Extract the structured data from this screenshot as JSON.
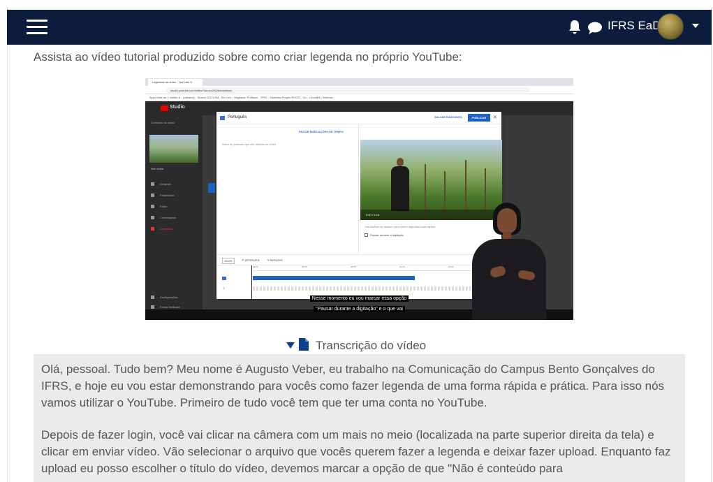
{
  "navbar": {
    "menu_icon": "hamburger-menu-icon",
    "notification_icon": "bell-icon",
    "messages_icon": "chat-bubble-icon",
    "user_name": "IFRS EaD",
    "background": "#0c1c3c"
  },
  "content": {
    "intro": "Assista ao vídeo tutorial produzido sobre como criar legenda no próprio YouTube:"
  },
  "video": {
    "browser_tab": "Legendas do vídeo - YouTube S",
    "url": "studio.youtube.com/video/?jm-svz0tQ/translations",
    "bookmarks": "Apps   Mais de 1 milhão d...   pdfcandy... Search   502.3 FM - Rio Gra...   Wayback: Profissio...   IFRS - Sistemas   Projeto RISOS - Go...   LinuxBR | Sistema...",
    "studio_label": "Studio",
    "sidebar": {
      "channel": "Conteúdo do canal",
      "video_title": "Seu vídeo",
      "items": [
        "Detalhes",
        "Estatísticas",
        "Editor",
        "Comentários",
        "Legendas"
      ],
      "footer": [
        "Configurações",
        "Enviar feedback"
      ]
    },
    "modal": {
      "title": "Português",
      "draft": "SALVAR RASCUNHO",
      "publish": "PUBLICAR",
      "edit_timestamps": "EDITAR MARCAÇÕES DE TEMPO",
      "hint": "Insira as palavras que são faladas no vídeo",
      "player_time": "0:00 / 0:18",
      "keyboard_link": "Use atalhos de teclado para inserir legendas mais rápido",
      "pause_option": "Pausar durante a digitação",
      "timeline_time": "00:00",
      "undo": "DESFAZER",
      "redo": "REFAZER",
      "ruler": [
        "00:00",
        "00:15",
        "00:30",
        "00:45",
        "01:00"
      ]
    },
    "captions": {
      "line1": "Nesse momento eu vou marcar essa opção",
      "line2": "\"Pausar durante a digitação\" e o que vai"
    }
  },
  "transcript": {
    "toggle_icon": "triangle-down-icon",
    "doc_icon": "file-icon",
    "title": "Transcrição do vídeo",
    "paragraph1": "Olá, pessoal. Tudo bem? Meu nome é Augusto Veber, eu trabalho na Comunicação do Campus Bento Gonçalves do IFRS, e hoje eu vou estar demonstrando para vocês como fazer legenda de uma forma rápida e prática. Para isso nós vamos utilizar o YouTube. Primeiro de tudo você tem que ter uma conta no YouTube.",
    "paragraph2": "Depois de fazer login, você vai clicar na câmera com um mais no meio (localizada na parte superior direita da tela) e clicar em enviar vídeo. Vão selecionar o arquivo que vocês querem fazer a legenda e deixar fazer upload. Enquanto faz upload eu posso escolher o título do vídeo, devemos marcar a opção de que \"Não é conteúdo para"
  }
}
